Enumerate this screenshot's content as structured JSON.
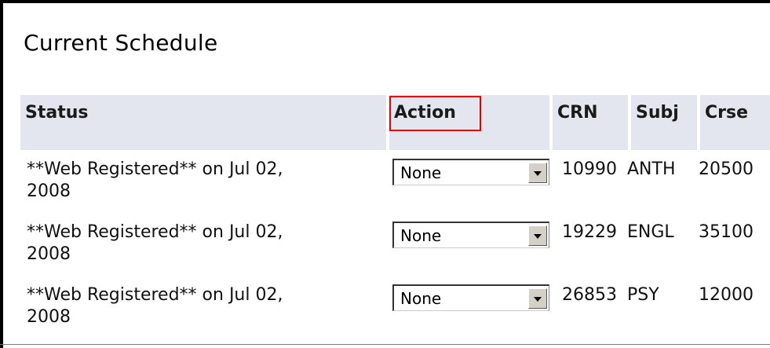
{
  "title": "Current Schedule",
  "columns": [
    "Status",
    "Action",
    "CRN",
    "Subj",
    "Crse"
  ],
  "rows": [
    {
      "status_line1": "**Web Registered** on Jul 02,",
      "status_line2": "2008",
      "action": "None",
      "crn": "10990",
      "subj": "ANTH",
      "crse": "20500"
    },
    {
      "status_line1": "**Web Registered** on Jul 02,",
      "status_line2": "2008",
      "action": "None",
      "crn": "19229",
      "subj": "ENGL",
      "crse": "35100"
    },
    {
      "status_line1": "**Web Registered** on Jul 02,",
      "status_line2": "2008",
      "action": "None",
      "crn": "26853",
      "subj": "PSY",
      "crse": "12000"
    }
  ],
  "highlight_color": "#e00000"
}
